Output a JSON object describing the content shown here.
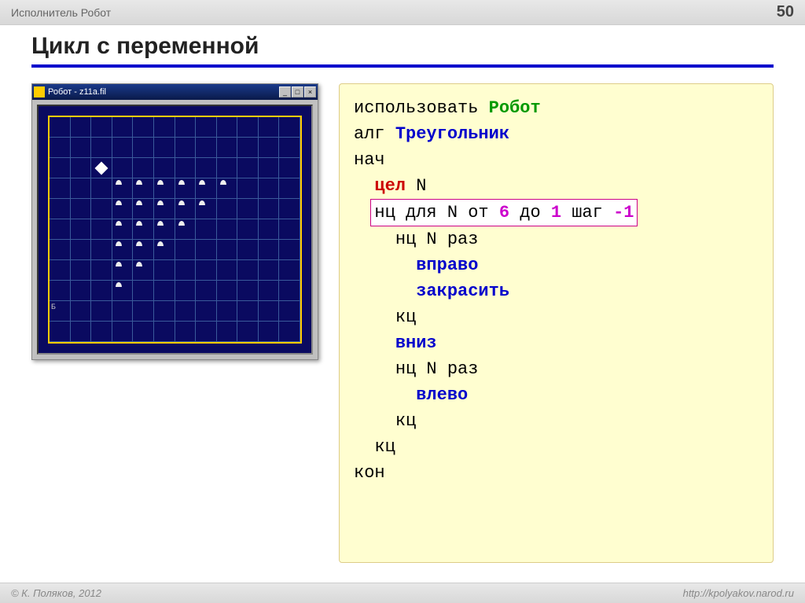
{
  "header": {
    "subject": "Исполнитель Робот",
    "page_number": "50"
  },
  "title": "Цикл с переменной",
  "robot_window": {
    "title": "Робот - z11a.fil",
    "grid": {
      "cols": 12,
      "rows": 11,
      "cursor": {
        "row": 2,
        "col": 2
      },
      "label_cell": {
        "row": 9,
        "col": 0,
        "text": "Б"
      },
      "marks": [
        {
          "row": 3,
          "col": 3
        },
        {
          "row": 3,
          "col": 4
        },
        {
          "row": 3,
          "col": 5
        },
        {
          "row": 3,
          "col": 6
        },
        {
          "row": 3,
          "col": 7
        },
        {
          "row": 3,
          "col": 8
        },
        {
          "row": 4,
          "col": 3
        },
        {
          "row": 4,
          "col": 4
        },
        {
          "row": 4,
          "col": 5
        },
        {
          "row": 4,
          "col": 6
        },
        {
          "row": 4,
          "col": 7
        },
        {
          "row": 5,
          "col": 3
        },
        {
          "row": 5,
          "col": 4
        },
        {
          "row": 5,
          "col": 5
        },
        {
          "row": 5,
          "col": 6
        },
        {
          "row": 6,
          "col": 3
        },
        {
          "row": 6,
          "col": 4
        },
        {
          "row": 6,
          "col": 5
        },
        {
          "row": 7,
          "col": 3
        },
        {
          "row": 7,
          "col": 4
        },
        {
          "row": 8,
          "col": 3
        }
      ]
    }
  },
  "code": {
    "l1": {
      "kw": "использовать",
      "arg": "Робот"
    },
    "l2": {
      "kw": "алг",
      "arg": "Треугольник"
    },
    "l3": "нач",
    "l4": {
      "kw": "цел",
      "var": "N"
    },
    "l5": {
      "p1": "нц для",
      "var": "N",
      "p2": "от",
      "v1": "6",
      "p3": "до",
      "v2": "1",
      "p4": "шаг",
      "v3": "-1"
    },
    "l6": {
      "kw": "нц",
      "var": "N",
      "p": "раз"
    },
    "l7": "вправо",
    "l8": "закрасить",
    "l9": "кц",
    "l10": "вниз",
    "l11": {
      "kw": "нц",
      "var": "N",
      "p": "раз"
    },
    "l12": "влево",
    "l13": "кц",
    "l14": "кц",
    "l15": "кон"
  },
  "footer": {
    "copyright": "© К. Поляков, 2012",
    "url": "http://kpolyakov.narod.ru"
  }
}
